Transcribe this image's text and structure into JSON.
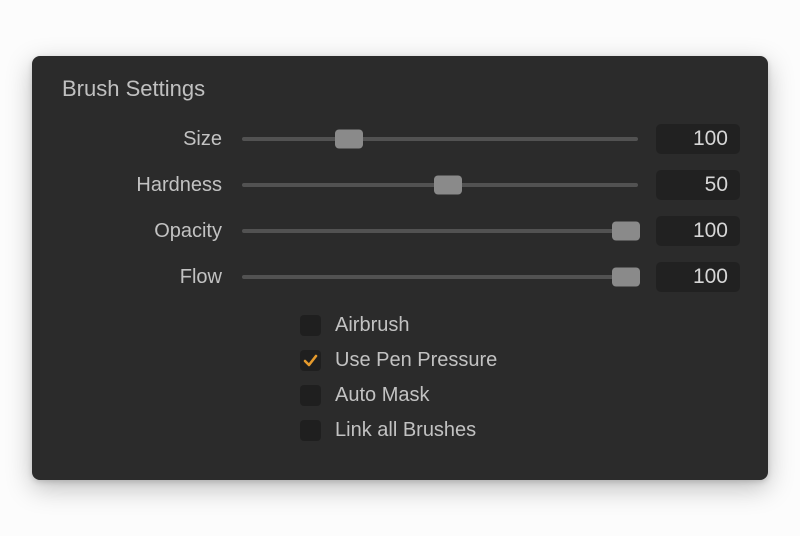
{
  "panel": {
    "title": "Brush Settings"
  },
  "sliders": {
    "size": {
      "label": "Size",
      "value": "100",
      "percent": 27
    },
    "hardness": {
      "label": "Hardness",
      "value": "50",
      "percent": 52
    },
    "opacity": {
      "label": "Opacity",
      "value": "100",
      "percent": 97
    },
    "flow": {
      "label": "Flow",
      "value": "100",
      "percent": 97
    }
  },
  "checkboxes": {
    "airbrush": {
      "label": "Airbrush",
      "checked": false
    },
    "pen_pressure": {
      "label": "Use Pen Pressure",
      "checked": true
    },
    "auto_mask": {
      "label": "Auto Mask",
      "checked": false
    },
    "link_brushes": {
      "label": "Link all Brushes",
      "checked": false
    }
  },
  "colors": {
    "accent_check": "#E59A2C"
  }
}
